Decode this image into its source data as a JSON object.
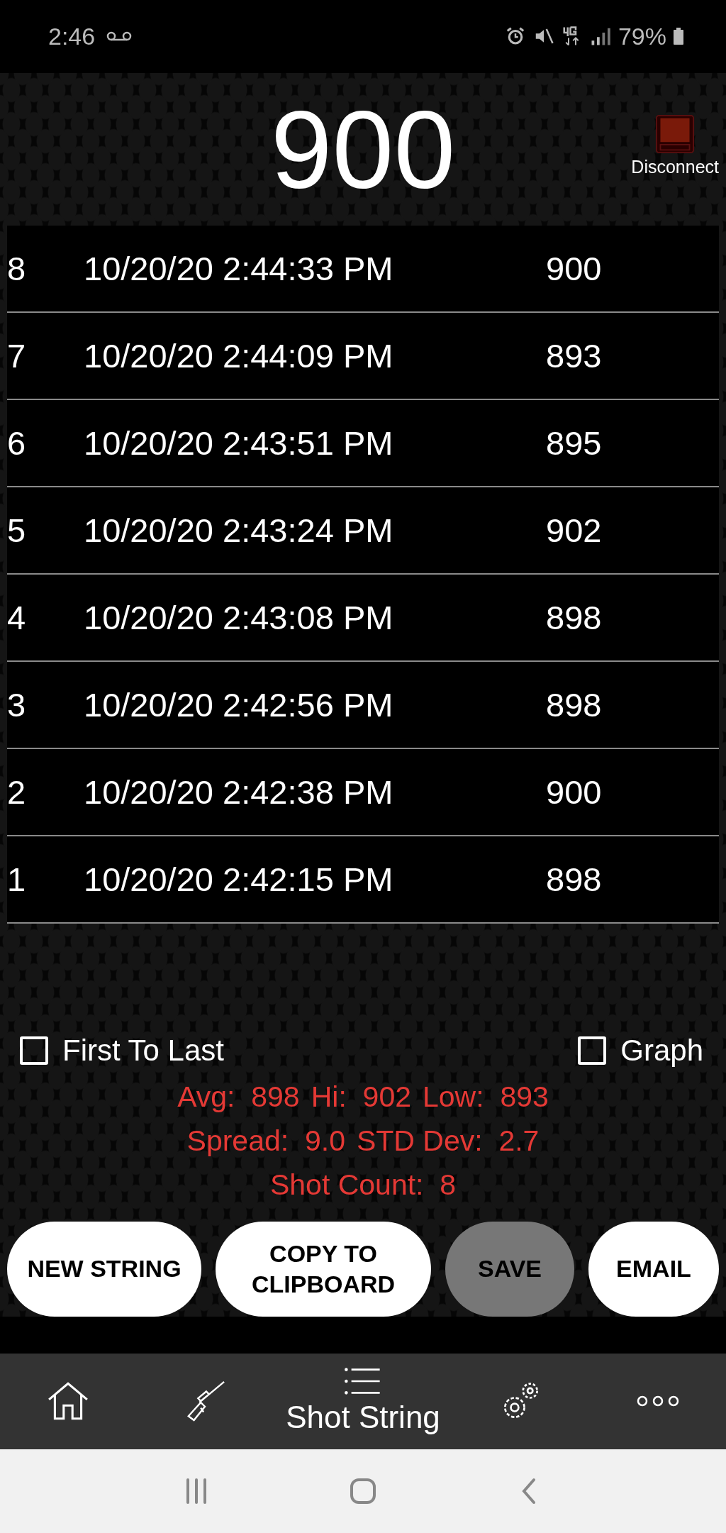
{
  "status_bar": {
    "time": "2:46",
    "battery": "79%"
  },
  "header": {
    "current_velocity": "900",
    "disconnect_label": "Disconnect"
  },
  "shots": [
    {
      "number": "8",
      "time": "10/20/20 2:44:33 PM",
      "velocity": "900"
    },
    {
      "number": "7",
      "time": "10/20/20 2:44:09 PM",
      "velocity": "893"
    },
    {
      "number": "6",
      "time": "10/20/20 2:43:51 PM",
      "velocity": "895"
    },
    {
      "number": "5",
      "time": "10/20/20 2:43:24 PM",
      "velocity": "902"
    },
    {
      "number": "4",
      "time": "10/20/20 2:43:08 PM",
      "velocity": "898"
    },
    {
      "number": "3",
      "time": "10/20/20 2:42:56 PM",
      "velocity": "898"
    },
    {
      "number": "2",
      "time": "10/20/20 2:42:38 PM",
      "velocity": "900"
    },
    {
      "number": "1",
      "time": "10/20/20 2:42:15 PM",
      "velocity": "898"
    }
  ],
  "options": [
    {
      "label": "First To Last",
      "checked": false
    },
    {
      "label": "Graph",
      "checked": false
    }
  ],
  "stats": [
    [
      {
        "label": "Avg:",
        "value": "898"
      },
      {
        "label": "Hi:",
        "value": "902"
      },
      {
        "label": "Low:",
        "value": "893"
      }
    ],
    [
      {
        "label": "Spread:",
        "value": "9.0"
      },
      {
        "label": "STD Dev:",
        "value": "2.7"
      }
    ],
    [
      {
        "label": "Shot Count:",
        "value": "8"
      }
    ]
  ],
  "buttons": [
    {
      "lines": [
        "NEW STRING"
      ],
      "disabled": false
    },
    {
      "lines": [
        "COPY TO",
        "CLIPBOARD"
      ],
      "disabled": false
    },
    {
      "lines": [
        "SAVE"
      ],
      "disabled": true
    },
    {
      "lines": [
        "EMAIL"
      ],
      "disabled": false
    }
  ],
  "nav": [
    {
      "kind": "home",
      "selected": false
    },
    {
      "kind": "rifle",
      "selected": false
    },
    {
      "kind": "list",
      "label": "Shot String",
      "selected": true
    },
    {
      "kind": "settings",
      "selected": false
    },
    {
      "kind": "more",
      "selected": false
    }
  ]
}
